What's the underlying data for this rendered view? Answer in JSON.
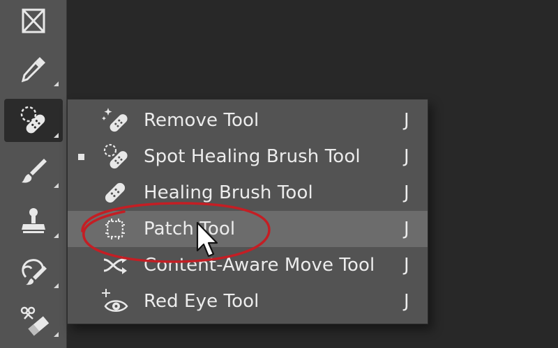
{
  "toolbar": {
    "tools": [
      {
        "icon": "frame-icon"
      },
      {
        "icon": "eyedropper-icon"
      },
      {
        "icon": "spot-healing-brush-icon",
        "active": true
      },
      {
        "icon": "brush-icon"
      },
      {
        "icon": "clone-stamp-icon"
      },
      {
        "icon": "history-brush-icon"
      },
      {
        "icon": "eraser-icon"
      }
    ]
  },
  "flyout": {
    "items": [
      {
        "label": "Remove Tool",
        "shortcut": "J",
        "icon": "remove-tool-icon",
        "selected": false,
        "highlighted": false
      },
      {
        "label": "Spot Healing Brush Tool",
        "shortcut": "J",
        "icon": "spot-healing-brush-icon",
        "selected": true,
        "highlighted": false
      },
      {
        "label": "Healing Brush Tool",
        "shortcut": "J",
        "icon": "healing-brush-icon",
        "selected": false,
        "highlighted": false
      },
      {
        "label": "Patch Tool",
        "shortcut": "J",
        "icon": "patch-tool-icon",
        "selected": false,
        "highlighted": true
      },
      {
        "label": "Content-Aware Move Tool",
        "shortcut": "J",
        "icon": "content-aware-move-icon",
        "selected": false,
        "highlighted": false
      },
      {
        "label": "Red Eye Tool",
        "shortcut": "J",
        "icon": "red-eye-icon",
        "selected": false,
        "highlighted": false
      }
    ]
  },
  "colors": {
    "toolbar_bg": "#535353",
    "canvas_bg": "#282828",
    "highlight_bg": "#6c6c6c",
    "annotation_red": "#c41e24"
  }
}
